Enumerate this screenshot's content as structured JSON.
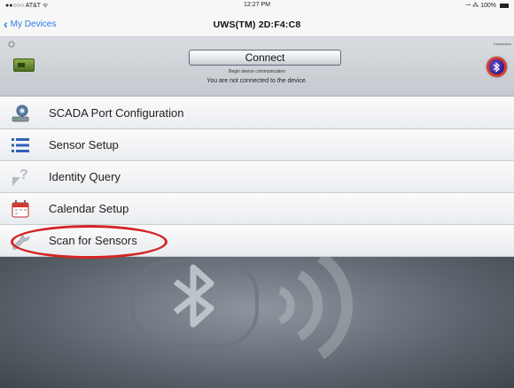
{
  "status_bar": {
    "carrier": "●●○○○ AT&T ᯤ",
    "time": "12:27 PM",
    "battery": "⇀ ⁂ 100%"
  },
  "nav": {
    "back_label": "My Devices",
    "title": "UWS(TM)  2D:F4:C8"
  },
  "connect_panel": {
    "connect_label": "Connect",
    "hint": "Begin device communication",
    "status": "You are not connected to the device.",
    "connection_label": "Connection"
  },
  "menu": {
    "items": [
      {
        "label": "SCADA Port Configuration",
        "icon": "scada-port-icon"
      },
      {
        "label": "Sensor Setup",
        "icon": "list-icon"
      },
      {
        "label": "Identity Query",
        "icon": "identity-query-icon"
      },
      {
        "label": "Calendar Setup",
        "icon": "calendar-icon"
      },
      {
        "label": "Scan for Sensors",
        "icon": "wrench-icon"
      }
    ]
  },
  "colors": {
    "accent": "#2a7be4",
    "highlight": "#d42424",
    "connection_indicator": "#d33b2c"
  }
}
